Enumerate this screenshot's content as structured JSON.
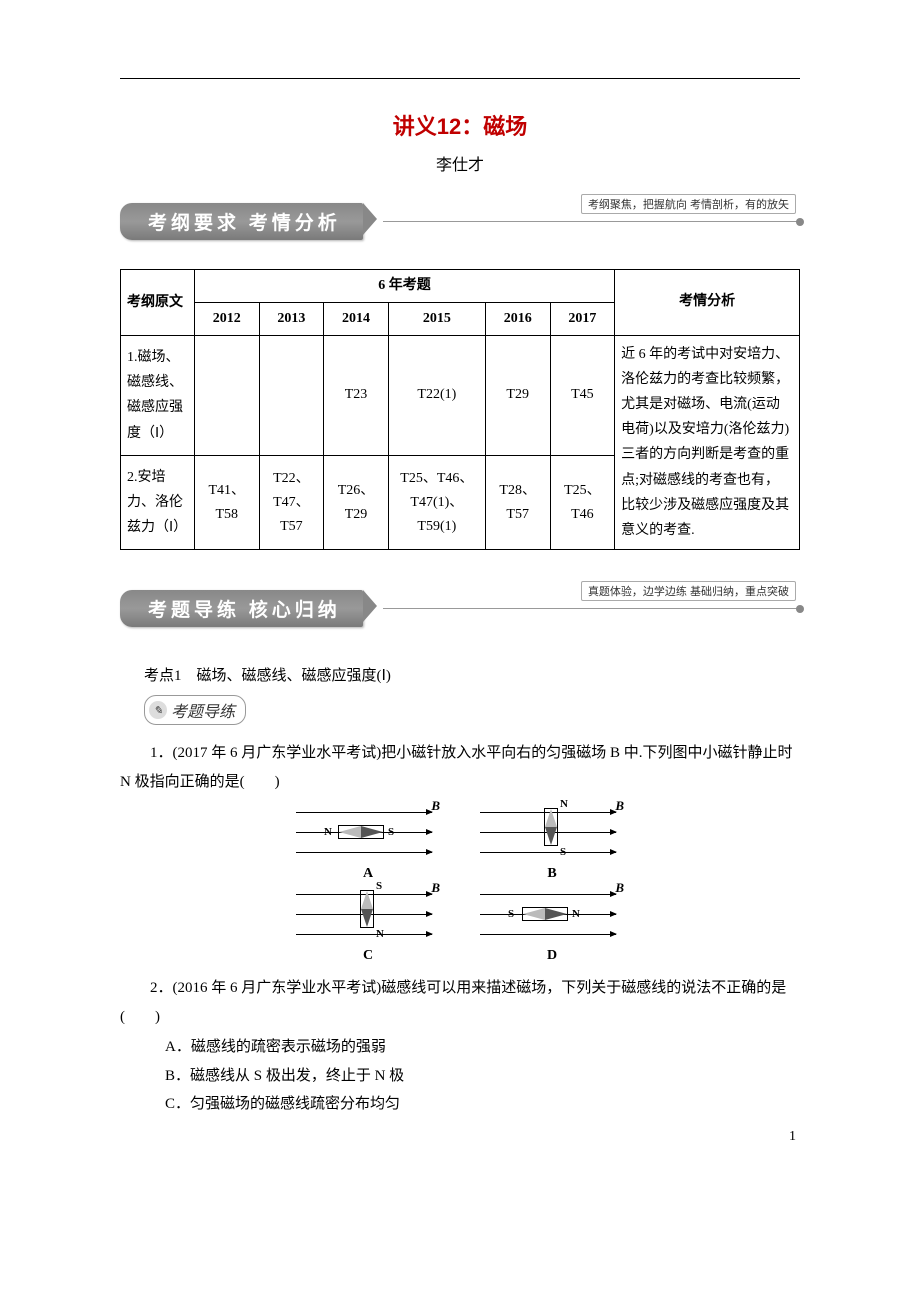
{
  "title": "讲义12：磁场",
  "author": "李仕才",
  "banner1": {
    "text": "考纲要求  考情分析",
    "caption": "考纲聚焦，把握航向  考情剖析，有的放矢"
  },
  "banner2": {
    "text": "考题导练  核心归纳",
    "caption": "真题体验，边学边练  基础归纳，重点突破"
  },
  "table": {
    "head": {
      "c0": "考纲原文",
      "c1": "6 年考题",
      "c2": "考情分析"
    },
    "years": [
      "2012",
      "2013",
      "2014",
      "2015",
      "2016",
      "2017"
    ],
    "rows": [
      {
        "topic": "1.磁场、磁感线、磁感应强度（Ⅰ）",
        "cells": [
          "",
          "",
          "T23",
          "T22(1)",
          "T29",
          "T45"
        ]
      },
      {
        "topic": "2.安培力、洛伦兹力（Ⅰ）",
        "cells": [
          "T41、T58",
          "T22、T47、T57",
          "T26、T29",
          "T25、T46、T47(1)、T59(1)",
          "T28、T57",
          "T25、T46"
        ]
      }
    ],
    "analysis": "近 6 年的考试中对安培力、洛伦兹力的考查比较频繁，尤其是对磁场、电流(运动电荷)以及安培力(洛伦兹力)三者的方向判断是考查的重点;对磁感线的考查也有，比较少涉及磁感应强度及其意义的考查."
  },
  "kaodian1": {
    "label": "考点1　磁场、磁感线、磁感应强度(Ⅰ)",
    "pill": "考题导练"
  },
  "q1": {
    "stem": "1．(2017 年 6 月广东学业水平考试)把小磁针放入水平向右的匀强磁场 B 中.下列图中小磁针静止时 N 极指向正确的是(　　)",
    "labels": {
      "B": "B",
      "N": "N",
      "S": "S",
      "A": "A",
      "Bopt": "B",
      "C": "C",
      "D": "D"
    }
  },
  "q2": {
    "stem": "2．(2016 年 6 月广东学业水平考试)磁感线可以用来描述磁场，下列关于磁感线的说法不正确的是(　　)",
    "A": "A．磁感线的疏密表示磁场的强弱",
    "B": "B．磁感线从 S 极出发，终止于 N 极",
    "C": "C．匀强磁场的磁感线疏密分布均匀"
  },
  "pageNum": "1"
}
